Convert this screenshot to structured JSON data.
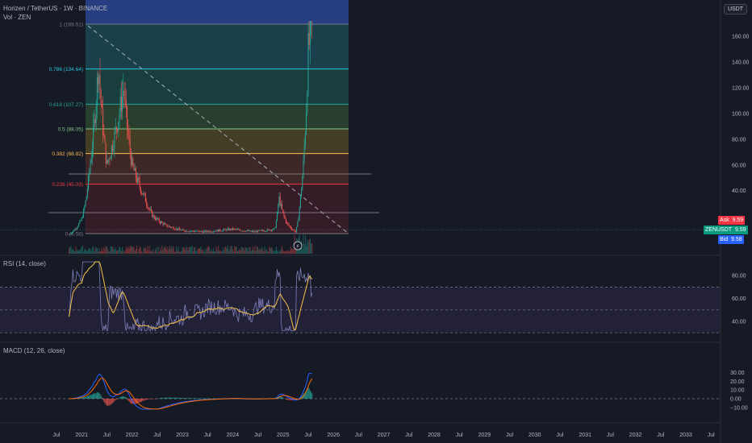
{
  "header": {
    "symbol_line": "Horizen / TetherUS · 1W · BINANCE",
    "volume_line": "Vol · ZEN",
    "currency_button": "USDT"
  },
  "price_tags": {
    "ask_label": "Ask",
    "ask_value": "9.59",
    "last_label": "ZENUSDT",
    "last_value": "9.59",
    "bid_label": "Bid",
    "bid_value": "9.58"
  },
  "rsi_title": "RSI (14, close)",
  "macd_title": "MACD (12, 26, close)",
  "colors": {
    "background": "#161a25",
    "up": "#26a69a",
    "down": "#ef5350",
    "rsi": "#7e7eb8",
    "rsi_ma": "#f5c148",
    "macd": "#2962ff",
    "signal": "#ff6d00"
  },
  "chart_data": [
    {
      "type": "candlestick",
      "title": "Horizen / TetherUS · 1W · BINANCE",
      "ylim": [
        0,
        175
      ],
      "y_ticks": [
        "160.00",
        "140.00",
        "120.00",
        "100.00",
        "80.00",
        "60.00",
        "40.00"
      ],
      "x_ticks": [
        "Jul",
        "2021",
        "Jul",
        "2022",
        "Jul",
        "2023",
        "Jul",
        "2024",
        "Jul",
        "2025",
        "Jul",
        "2026",
        "Jul",
        "2027",
        "Jul",
        "2028",
        "Jul",
        "2029",
        "Jul",
        "2030",
        "Jul",
        "2031",
        "Jul",
        "2032",
        "Jul",
        "2033",
        "Jul"
      ],
      "x_tick_dates": [
        "2020-07",
        "2021-01",
        "2021-07",
        "2022-01",
        "2022-07",
        "2023-01",
        "2023-07",
        "2024-01",
        "2024-07",
        "2025-01",
        "2025-07",
        "2026-01",
        "2026-07",
        "2027-01",
        "2027-07",
        "2028-01",
        "2028-07",
        "2029-01",
        "2029-07",
        "2030-01",
        "2030-07",
        "2031-01",
        "2031-07",
        "2032-01",
        "2032-07",
        "2033-01",
        "2033-07"
      ],
      "series_anchor_points": [
        {
          "date": "2020-10",
          "close": 6
        },
        {
          "date": "2021-01",
          "close": 18
        },
        {
          "date": "2021-03",
          "close": 60
        },
        {
          "date": "2021-05",
          "close": 140
        },
        {
          "date": "2021-07",
          "close": 60
        },
        {
          "date": "2021-09",
          "close": 85
        },
        {
          "date": "2021-11",
          "close": 120
        },
        {
          "date": "2022-01",
          "close": 60
        },
        {
          "date": "2022-04",
          "close": 35
        },
        {
          "date": "2022-06",
          "close": 20
        },
        {
          "date": "2022-09",
          "close": 13
        },
        {
          "date": "2023-01",
          "close": 9
        },
        {
          "date": "2023-06",
          "close": 8
        },
        {
          "date": "2024-01",
          "close": 10
        },
        {
          "date": "2024-06",
          "close": 8
        },
        {
          "date": "2024-11",
          "close": 10
        },
        {
          "date": "2024-12",
          "close": 35
        },
        {
          "date": "2025-02",
          "close": 14
        },
        {
          "date": "2025-04",
          "close": 8
        },
        {
          "date": "2025-05",
          "close": 30
        },
        {
          "date": "2025-06",
          "close": 70
        },
        {
          "date": "2025-07",
          "close": 150
        },
        {
          "date": "2025-08",
          "close": 169.51
        }
      ],
      "fibonacci": [
        {
          "ratio": "1",
          "value": 169.51,
          "label": "1 (169.51)",
          "color": "#787b86"
        },
        {
          "ratio": "0.786",
          "value": 134.64,
          "label": "0.786 (134.64)",
          "color": "#26c6da"
        },
        {
          "ratio": "0.618",
          "value": 107.27,
          "label": "0.618 (107.27)",
          "color": "#26a69a"
        },
        {
          "ratio": "0.5",
          "value": 88.05,
          "label": "0.5 (88.05)",
          "color": "#81c784"
        },
        {
          "ratio": "0.382",
          "value": 68.82,
          "label": "0.382 (68.82)",
          "color": "#ffb74d"
        },
        {
          "ratio": "0.236",
          "value": 45.03,
          "label": "0.236 (45.03)",
          "color": "#f23645"
        },
        {
          "ratio": "0",
          "value": 6.58,
          "label": "0 (6.58)",
          "color": "#787b86"
        }
      ],
      "last_price": 9.59,
      "grid": false
    },
    {
      "type": "line",
      "title": "RSI (14, close)",
      "ylim": [
        30,
        90
      ],
      "y_ticks": [
        "80.00",
        "60.00",
        "40.00"
      ],
      "bands": [
        70,
        50,
        30
      ]
    },
    {
      "type": "bar",
      "title": "MACD (12, 26, close)",
      "ylim": [
        -14,
        32
      ],
      "y_ticks": [
        "30.00",
        "20.00",
        "10.00",
        "0.00",
        "−10.00"
      ]
    }
  ]
}
